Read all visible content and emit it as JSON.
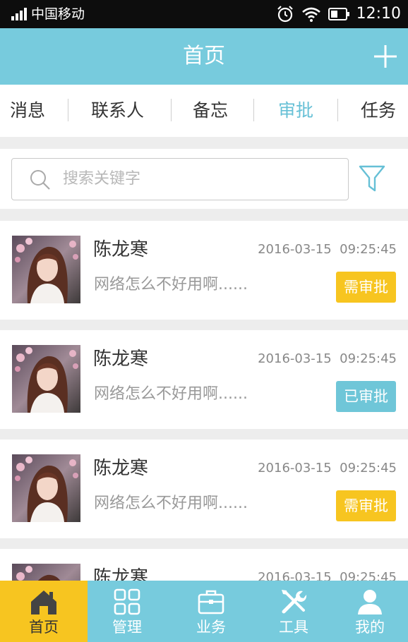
{
  "status_bar": {
    "carrier": "中国移动",
    "time": "12:10",
    "icons": [
      "signal-icon",
      "alarm-icon",
      "wifi-icon",
      "battery-icon"
    ]
  },
  "header": {
    "title": "首页",
    "add_icon": "plus-icon"
  },
  "tabs": [
    {
      "label": "消息",
      "active": false
    },
    {
      "label": "联系人",
      "active": false
    },
    {
      "label": "备忘",
      "active": false
    },
    {
      "label": "审批",
      "active": true
    },
    {
      "label": "任务",
      "active": false
    }
  ],
  "search": {
    "placeholder": "搜索关键字",
    "filter_icon": "funnel-icon"
  },
  "list": [
    {
      "name": "陈龙寒",
      "date": "2016-03-15",
      "time": "09:25:45",
      "message": "网络怎么不好用啊......",
      "status": "需审批",
      "status_type": "pending"
    },
    {
      "name": "陈龙寒",
      "date": "2016-03-15",
      "time": "09:25:45",
      "message": "网络怎么不好用啊......",
      "status": "已审批",
      "status_type": "done"
    },
    {
      "name": "陈龙寒",
      "date": "2016-03-15",
      "time": "09:25:45",
      "message": "网络怎么不好用啊......",
      "status": "需审批",
      "status_type": "pending"
    },
    {
      "name": "陈龙寒",
      "date": "2016-03-15",
      "time": "09:25:45",
      "message": "",
      "status": "",
      "status_type": ""
    }
  ],
  "bottom_nav": [
    {
      "label": "首页",
      "icon": "home-icon",
      "active": true
    },
    {
      "label": "管理",
      "icon": "grid-icon",
      "active": false
    },
    {
      "label": "业务",
      "icon": "briefcase-icon",
      "active": false
    },
    {
      "label": "工具",
      "icon": "tools-icon",
      "active": false
    },
    {
      "label": "我的",
      "icon": "person-icon",
      "active": false
    }
  ],
  "colors": {
    "primary": "#77cbdd",
    "accent_text": "#66c0d6",
    "pending": "#f7c520",
    "approved": "#6fc6d8"
  }
}
